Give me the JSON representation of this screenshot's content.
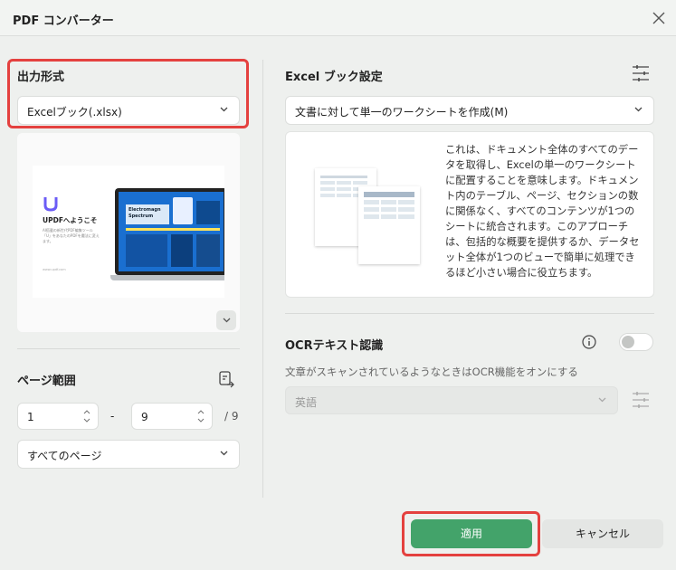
{
  "window": {
    "title": "PDF コンバーター",
    "close_icon": "close-icon"
  },
  "output_format": {
    "heading": "出力形式",
    "selected": "Excelブック(.xlsx)"
  },
  "preview": {
    "welcome_title": "UPDFへようこそ",
    "welcome_sub": "AI搭載の新世代PDF編集ツール「U」をあなたのPDFを魔法に変えます。",
    "screen_title_1": "Electromagn",
    "screen_title_2": "Spectrum",
    "footer_text": "www.updf.com"
  },
  "page_range": {
    "heading": "ページ範囲",
    "from": "1",
    "separator": "-",
    "to": "9",
    "total": "/ 9",
    "pages_option": "すべてのページ"
  },
  "excel_settings": {
    "heading": "Excel ブック設定",
    "mode": "文書に対して単一のワークシートを作成(M)",
    "description": "これは、ドキュメント全体のすべてのデータを取得し、Excelの単一のワークシートに配置することを意味します。ドキュメント内のテーブル、ページ、セクションの数に関係なく、すべてのコンテンツが1つのシートに統合されます。このアプローチは、包括的な概要を提供するか、データセット全体が1つのビューで簡単に処理できるほど小さい場合に役立ちます。"
  },
  "ocr": {
    "heading": "OCRテキスト認識",
    "enabled": false,
    "hint": "文章がスキャンされているようなときはOCR機能をオンにする",
    "language": "英語"
  },
  "buttons": {
    "apply": "適用",
    "cancel": "キャンセル"
  },
  "colors": {
    "accent_green": "#43a36a",
    "highlight_red": "#e4413f",
    "background": "#eef0ee"
  }
}
